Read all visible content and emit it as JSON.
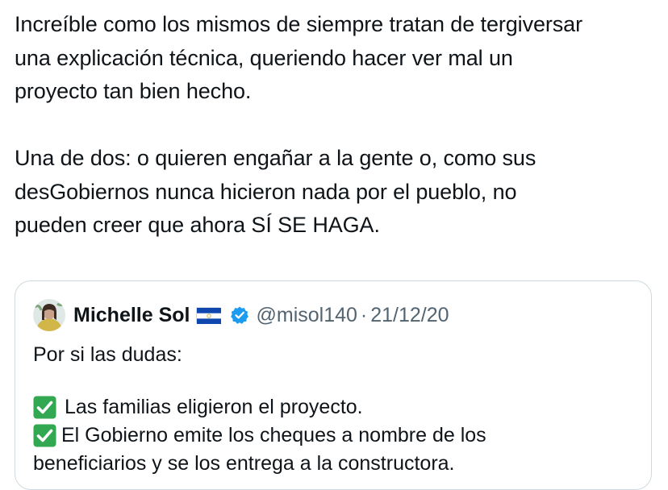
{
  "post": {
    "paragraph1": [
      "Increíble como los mismos de siempre tratan de tergiversar",
      "una explicación técnica, queriendo hacer ver mal un",
      "proyecto tan bien hecho."
    ],
    "paragraph2": [
      "Una de dos: o quieren engañar a la gente o, como sus",
      "desGobiernos nunca hicieron nada por el pueblo, no",
      "pueden creer que ahora SÍ SE HAGA."
    ]
  },
  "quoted_post": {
    "display_name": "Michelle Sol",
    "flag_icon": "el-salvador-flag-icon",
    "verified_icon": "verified-badge-icon",
    "handle": "@misol140",
    "separator": "·",
    "date": "21/12/20",
    "intro": "Por si las dudas:",
    "items": [
      "Las familias eligieron el proyecto.",
      "El Gobierno emite los cheques a nombre de los",
      "beneficiarios y se los entrega a la constructora."
    ],
    "check_icon": "check-mark-button-icon",
    "colors": {
      "verified": "#1d9bf0",
      "check": "#32a852",
      "border": "#cfd9de",
      "muted_text": "#536471"
    }
  }
}
